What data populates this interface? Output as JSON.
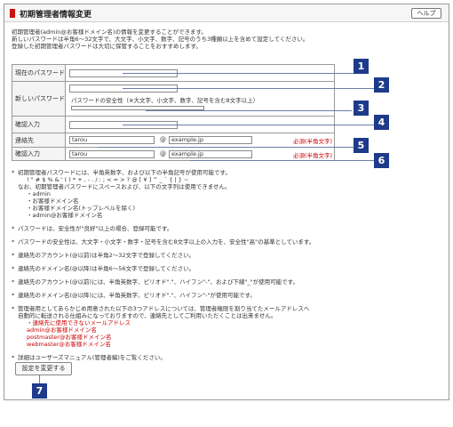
{
  "header": {
    "title": "初期管理者情報変更",
    "help_label": "ヘルプ"
  },
  "intro": [
    "初期管理者(admin@お客様ドメイン名)の情報を変更することができます。",
    "新しいパスワードは半角6〜32文字で、大文字、小文字、数字、記号のうち3種類以上を含めて設定してください。",
    "登録した初期管理者パスワードは大切に保管することをおすすめします。"
  ],
  "form": {
    "current_password_label": "現在のパスワード",
    "new_password_label": "新しいパスワード",
    "strength_label": "パスワードの安全性（※大文字、小文字、数字、記号を含む8文字以上）",
    "confirm_label": "確認入力",
    "contact_label": "連絡先",
    "contact_confirm_label": "確認入力",
    "contact_name": "tarou",
    "contact_domain": "example.jp",
    "confirm_name": "tarou",
    "confirm_domain": "example.jp",
    "at_sign": "@",
    "required_label": "必須(半角文字)"
  },
  "callouts": [
    "1",
    "2",
    "3",
    "4",
    "5",
    "6",
    "7"
  ],
  "notes": {
    "n1": "初期管理者パスワードには、半角英数字、および以下の半角記号が使用可能です。",
    "n1_symbols": "! \" # $ % & ' ( ) * + , - . / : ; < = > ? @ [ ¥ ] ^ _ ` { | } ~",
    "n1_b": "なお、初期管理者パスワードにスペースおよび、以下の文字列は使用できません。",
    "n1_list": [
      "・admin",
      "・お客様ドメイン名",
      "・お客様ドメイン名(トップレベルを除く)",
      "・admin@お客様ドメイン名"
    ],
    "n2": "パスワードは、安全性が\"良好\"以上の場合、登録可能です。",
    "n3": "パスワードの安全性は、大文字・小文字・数字・記号を含む8文字以上の入力を、安全性\"高\"の基準としています。",
    "n4": "連絡先のアカウント(@以前)は半角2〜32文字で登録してください。",
    "n5": "連絡先のドメイン名(@以降)は半角6〜56文字で登録してください。",
    "n6": "連絡先のアカウント(@以前)には、半角英数字、ピリオド\".\"、ハイフン\"-\"、および下線\"_\"が使用可能です。",
    "n7": "連絡先のドメイン名(@以降)には、半角英数字、ピリオド\".\"、ハイフン\"-\"が使用可能です。",
    "n8": "管理者用としてあらかじめ用意された以下の3つアドレスについては、管理者権限を割り当てたメールアドレスへ",
    "n8_b": "自動的に転送される仕組みになっておりますので、連絡先としてご利用いただくことは出来ません。",
    "n8_list": [
      "・連絡先に使用できないメールアドレス",
      "admin@お客様ドメイン名",
      "postmaster@お客様ドメイン名",
      "webmaster@お客様ドメイン名"
    ],
    "n9": "詳細はユーザーズマニュアル(管理者編)をご覧ください。"
  },
  "submit_label": "設定を変更する",
  "colors": {
    "accent": "#cc1111",
    "callout": "#1e3a8a",
    "required": "#cc0000"
  }
}
